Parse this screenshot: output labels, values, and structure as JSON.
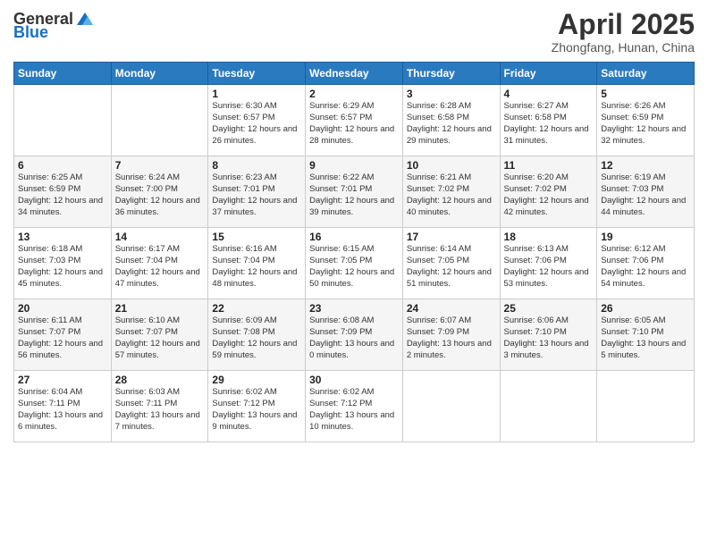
{
  "header": {
    "logo_general": "General",
    "logo_blue": "Blue",
    "month_title": "April 2025",
    "location": "Zhongfang, Hunan, China"
  },
  "days_of_week": [
    "Sunday",
    "Monday",
    "Tuesday",
    "Wednesday",
    "Thursday",
    "Friday",
    "Saturday"
  ],
  "weeks": [
    [
      {
        "day": "",
        "sunrise": "",
        "sunset": "",
        "daylight": ""
      },
      {
        "day": "",
        "sunrise": "",
        "sunset": "",
        "daylight": ""
      },
      {
        "day": "1",
        "sunrise": "Sunrise: 6:30 AM",
        "sunset": "Sunset: 6:57 PM",
        "daylight": "Daylight: 12 hours and 26 minutes."
      },
      {
        "day": "2",
        "sunrise": "Sunrise: 6:29 AM",
        "sunset": "Sunset: 6:57 PM",
        "daylight": "Daylight: 12 hours and 28 minutes."
      },
      {
        "day": "3",
        "sunrise": "Sunrise: 6:28 AM",
        "sunset": "Sunset: 6:58 PM",
        "daylight": "Daylight: 12 hours and 29 minutes."
      },
      {
        "day": "4",
        "sunrise": "Sunrise: 6:27 AM",
        "sunset": "Sunset: 6:58 PM",
        "daylight": "Daylight: 12 hours and 31 minutes."
      },
      {
        "day": "5",
        "sunrise": "Sunrise: 6:26 AM",
        "sunset": "Sunset: 6:59 PM",
        "daylight": "Daylight: 12 hours and 32 minutes."
      }
    ],
    [
      {
        "day": "6",
        "sunrise": "Sunrise: 6:25 AM",
        "sunset": "Sunset: 6:59 PM",
        "daylight": "Daylight: 12 hours and 34 minutes."
      },
      {
        "day": "7",
        "sunrise": "Sunrise: 6:24 AM",
        "sunset": "Sunset: 7:00 PM",
        "daylight": "Daylight: 12 hours and 36 minutes."
      },
      {
        "day": "8",
        "sunrise": "Sunrise: 6:23 AM",
        "sunset": "Sunset: 7:01 PM",
        "daylight": "Daylight: 12 hours and 37 minutes."
      },
      {
        "day": "9",
        "sunrise": "Sunrise: 6:22 AM",
        "sunset": "Sunset: 7:01 PM",
        "daylight": "Daylight: 12 hours and 39 minutes."
      },
      {
        "day": "10",
        "sunrise": "Sunrise: 6:21 AM",
        "sunset": "Sunset: 7:02 PM",
        "daylight": "Daylight: 12 hours and 40 minutes."
      },
      {
        "day": "11",
        "sunrise": "Sunrise: 6:20 AM",
        "sunset": "Sunset: 7:02 PM",
        "daylight": "Daylight: 12 hours and 42 minutes."
      },
      {
        "day": "12",
        "sunrise": "Sunrise: 6:19 AM",
        "sunset": "Sunset: 7:03 PM",
        "daylight": "Daylight: 12 hours and 44 minutes."
      }
    ],
    [
      {
        "day": "13",
        "sunrise": "Sunrise: 6:18 AM",
        "sunset": "Sunset: 7:03 PM",
        "daylight": "Daylight: 12 hours and 45 minutes."
      },
      {
        "day": "14",
        "sunrise": "Sunrise: 6:17 AM",
        "sunset": "Sunset: 7:04 PM",
        "daylight": "Daylight: 12 hours and 47 minutes."
      },
      {
        "day": "15",
        "sunrise": "Sunrise: 6:16 AM",
        "sunset": "Sunset: 7:04 PM",
        "daylight": "Daylight: 12 hours and 48 minutes."
      },
      {
        "day": "16",
        "sunrise": "Sunrise: 6:15 AM",
        "sunset": "Sunset: 7:05 PM",
        "daylight": "Daylight: 12 hours and 50 minutes."
      },
      {
        "day": "17",
        "sunrise": "Sunrise: 6:14 AM",
        "sunset": "Sunset: 7:05 PM",
        "daylight": "Daylight: 12 hours and 51 minutes."
      },
      {
        "day": "18",
        "sunrise": "Sunrise: 6:13 AM",
        "sunset": "Sunset: 7:06 PM",
        "daylight": "Daylight: 12 hours and 53 minutes."
      },
      {
        "day": "19",
        "sunrise": "Sunrise: 6:12 AM",
        "sunset": "Sunset: 7:06 PM",
        "daylight": "Daylight: 12 hours and 54 minutes."
      }
    ],
    [
      {
        "day": "20",
        "sunrise": "Sunrise: 6:11 AM",
        "sunset": "Sunset: 7:07 PM",
        "daylight": "Daylight: 12 hours and 56 minutes."
      },
      {
        "day": "21",
        "sunrise": "Sunrise: 6:10 AM",
        "sunset": "Sunset: 7:07 PM",
        "daylight": "Daylight: 12 hours and 57 minutes."
      },
      {
        "day": "22",
        "sunrise": "Sunrise: 6:09 AM",
        "sunset": "Sunset: 7:08 PM",
        "daylight": "Daylight: 12 hours and 59 minutes."
      },
      {
        "day": "23",
        "sunrise": "Sunrise: 6:08 AM",
        "sunset": "Sunset: 7:09 PM",
        "daylight": "Daylight: 13 hours and 0 minutes."
      },
      {
        "day": "24",
        "sunrise": "Sunrise: 6:07 AM",
        "sunset": "Sunset: 7:09 PM",
        "daylight": "Daylight: 13 hours and 2 minutes."
      },
      {
        "day": "25",
        "sunrise": "Sunrise: 6:06 AM",
        "sunset": "Sunset: 7:10 PM",
        "daylight": "Daylight: 13 hours and 3 minutes."
      },
      {
        "day": "26",
        "sunrise": "Sunrise: 6:05 AM",
        "sunset": "Sunset: 7:10 PM",
        "daylight": "Daylight: 13 hours and 5 minutes."
      }
    ],
    [
      {
        "day": "27",
        "sunrise": "Sunrise: 6:04 AM",
        "sunset": "Sunset: 7:11 PM",
        "daylight": "Daylight: 13 hours and 6 minutes."
      },
      {
        "day": "28",
        "sunrise": "Sunrise: 6:03 AM",
        "sunset": "Sunset: 7:11 PM",
        "daylight": "Daylight: 13 hours and 7 minutes."
      },
      {
        "day": "29",
        "sunrise": "Sunrise: 6:02 AM",
        "sunset": "Sunset: 7:12 PM",
        "daylight": "Daylight: 13 hours and 9 minutes."
      },
      {
        "day": "30",
        "sunrise": "Sunrise: 6:02 AM",
        "sunset": "Sunset: 7:12 PM",
        "daylight": "Daylight: 13 hours and 10 minutes."
      },
      {
        "day": "",
        "sunrise": "",
        "sunset": "",
        "daylight": ""
      },
      {
        "day": "",
        "sunrise": "",
        "sunset": "",
        "daylight": ""
      },
      {
        "day": "",
        "sunrise": "",
        "sunset": "",
        "daylight": ""
      }
    ]
  ]
}
